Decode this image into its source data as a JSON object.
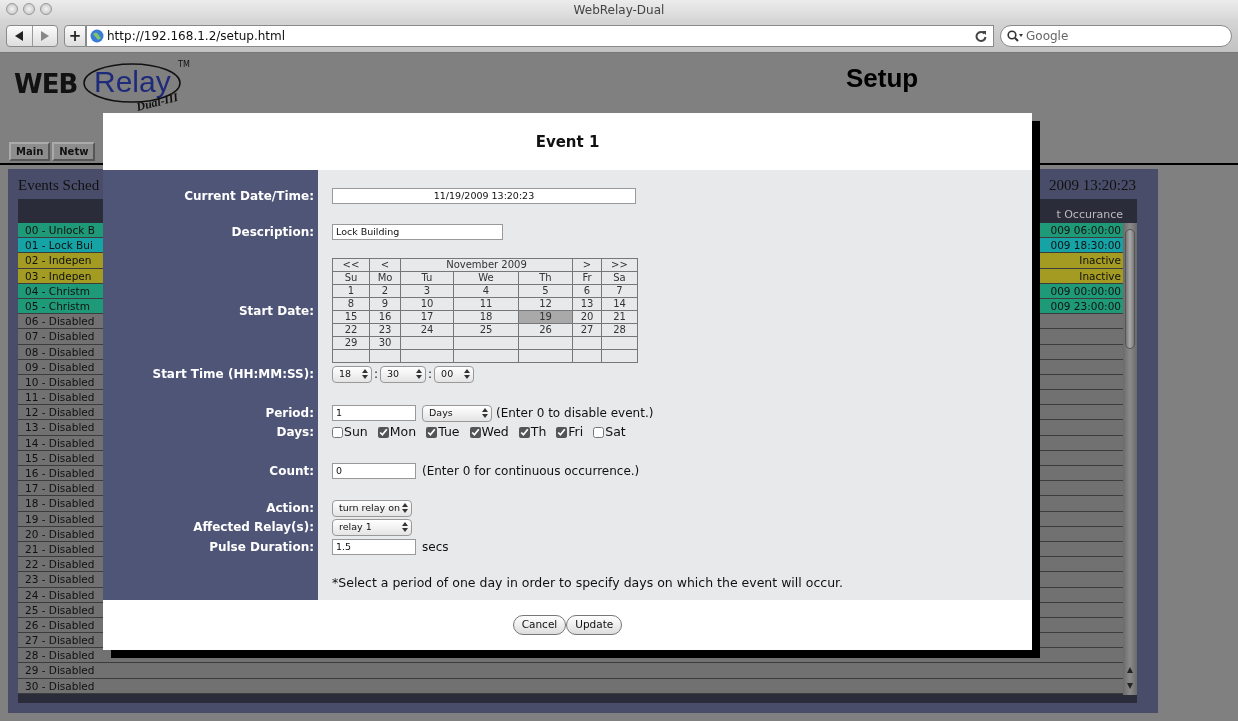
{
  "browser": {
    "title": "WebRelay-Dual",
    "plus": "+",
    "url": "http://192.168.1.2/setup.html",
    "search_placeholder": "Google"
  },
  "header": {
    "logo": {
      "web": "WEB",
      "relay": "Relay",
      "tm": "TM",
      "model": "Dual-III"
    },
    "title": "Setup"
  },
  "tabs": [
    {
      "label": "Main",
      "selected": false
    },
    {
      "label": "Netw",
      "selected": false
    }
  ],
  "events": {
    "title": "Events Sched",
    "current_time": "2009 13:20:23",
    "column_header": "t Occurance",
    "rows": [
      {
        "name": "00 - Unlock B",
        "next": "009 06:00:00",
        "color": "#1f9a78"
      },
      {
        "name": "01 - Lock Bui",
        "next": "009 18:30:00",
        "color": "#15a3a6"
      },
      {
        "name": "02 - Indepen",
        "next": "Inactive",
        "color": "#a39b22"
      },
      {
        "name": "03 - Indepen",
        "next": "Inactive",
        "color": "#a39b22"
      },
      {
        "name": "04 - Christm",
        "next": "009 00:00:00",
        "color": "#1f9a78"
      },
      {
        "name": "05 - Christm",
        "next": "009 23:00:00",
        "color": "#1f9a78"
      },
      {
        "name": "06 - Disabled",
        "color": "#717171"
      },
      {
        "name": "07 - Disabled",
        "color": "#717171"
      },
      {
        "name": "08 - Disabled",
        "color": "#717171"
      },
      {
        "name": "09 - Disabled",
        "color": "#717171"
      },
      {
        "name": "10 - Disabled",
        "color": "#717171"
      },
      {
        "name": "11 - Disabled",
        "color": "#717171"
      },
      {
        "name": "12 - Disabled",
        "color": "#717171"
      },
      {
        "name": "13 - Disabled",
        "color": "#717171"
      },
      {
        "name": "14 - Disabled",
        "color": "#717171"
      },
      {
        "name": "15 - Disabled",
        "color": "#717171"
      },
      {
        "name": "16 - Disabled",
        "color": "#717171"
      },
      {
        "name": "17 - Disabled",
        "color": "#717171"
      },
      {
        "name": "18 - Disabled",
        "color": "#717171"
      },
      {
        "name": "19 - Disabled",
        "color": "#717171"
      },
      {
        "name": "20 - Disabled",
        "color": "#717171"
      },
      {
        "name": "21 - Disabled",
        "color": "#717171"
      },
      {
        "name": "22 - Disabled",
        "color": "#717171"
      },
      {
        "name": "23 - Disabled",
        "color": "#717171"
      },
      {
        "name": "24 - Disabled",
        "color": "#717171"
      },
      {
        "name": "25 - Disabled",
        "color": "#717171"
      },
      {
        "name": "26 - Disabled",
        "color": "#717171"
      },
      {
        "name": "27 - Disabled",
        "color": "#717171"
      },
      {
        "name": "28 - Disabled",
        "color": "#717171"
      },
      {
        "name": "29 - Disabled",
        "color": "#717171"
      },
      {
        "name": "30 - Disabled",
        "color": "#717171"
      }
    ]
  },
  "modal": {
    "title": "Event 1",
    "current_label": "Current Date/Time:",
    "current_value": "11/19/2009 13:20:23",
    "description_label": "Description:",
    "description_value": "Lock Building",
    "start_date_label": "Start Date:",
    "start_date": {
      "nav": [
        "<<",
        "<",
        ">",
        ">>"
      ],
      "month": "November 2009",
      "weekdays": [
        "Su",
        "Mo",
        "Tu",
        "We",
        "Th",
        "Fr",
        "Sa"
      ],
      "weeks": [
        {
          "days": [
            {
              "day": "1",
              "selected": false
            },
            {
              "day": "2",
              "selected": false
            },
            {
              "day": "3",
              "selected": false
            },
            {
              "day": "4",
              "selected": false
            },
            {
              "day": "5",
              "selected": false
            },
            {
              "day": "6",
              "selected": false
            },
            {
              "day": "7",
              "selected": false
            }
          ]
        },
        {
          "days": [
            {
              "day": "8",
              "selected": false
            },
            {
              "day": "9",
              "selected": false
            },
            {
              "day": "10",
              "selected": false
            },
            {
              "day": "11",
              "selected": false
            },
            {
              "day": "12",
              "selected": false
            },
            {
              "day": "13",
              "selected": false
            },
            {
              "day": "14",
              "selected": false
            }
          ]
        },
        {
          "days": [
            {
              "day": "15",
              "selected": false
            },
            {
              "day": "16",
              "selected": false
            },
            {
              "day": "17",
              "selected": false
            },
            {
              "day": "18",
              "selected": false
            },
            {
              "day": "19",
              "selected": true
            },
            {
              "day": "20",
              "selected": false
            },
            {
              "day": "21",
              "selected": false
            }
          ]
        },
        {
          "days": [
            {
              "day": "22",
              "selected": false
            },
            {
              "day": "23",
              "selected": false
            },
            {
              "day": "24",
              "selected": false
            },
            {
              "day": "25",
              "selected": false
            },
            {
              "day": "26",
              "selected": false
            },
            {
              "day": "27",
              "selected": false
            },
            {
              "day": "28",
              "selected": false
            }
          ]
        },
        {
          "days": [
            {
              "day": "29",
              "selected": false
            },
            {
              "day": "30",
              "selected": false
            }
          ]
        }
      ]
    },
    "start_time_label": "Start Time (HH:MM:SS):",
    "hours": "18",
    "minutes": "30",
    "seconds": "00",
    "time_separator": ":",
    "period_label": "Period:",
    "period_value": "1",
    "period_unit": "Days",
    "period_hint": "(Enter 0 to disable event.)",
    "days_label": "Days:",
    "days": [
      {
        "label": "Sun",
        "checked": false
      },
      {
        "label": "Mon",
        "checked": true
      },
      {
        "label": "Tue",
        "checked": true
      },
      {
        "label": "Wed",
        "checked": true
      },
      {
        "label": "Th",
        "checked": true
      },
      {
        "label": "Fri",
        "checked": true
      },
      {
        "label": "Sat",
        "checked": false
      }
    ],
    "count_label": "Count:",
    "count_value": "0",
    "count_hint": "(Enter 0 for continuous occurrence.)",
    "action_label": "Action:",
    "action_value": "turn relay on",
    "relay_label": "Affected Relay(s):",
    "relay_value": "relay 1",
    "pulse_label": "Pulse Duration:",
    "pulse_value": "1.5",
    "pulse_unit": "secs",
    "note": "*Select a period of one day in order to specify days on which the event will occur.",
    "buttons": [
      "Cancel",
      "Update"
    ]
  }
}
